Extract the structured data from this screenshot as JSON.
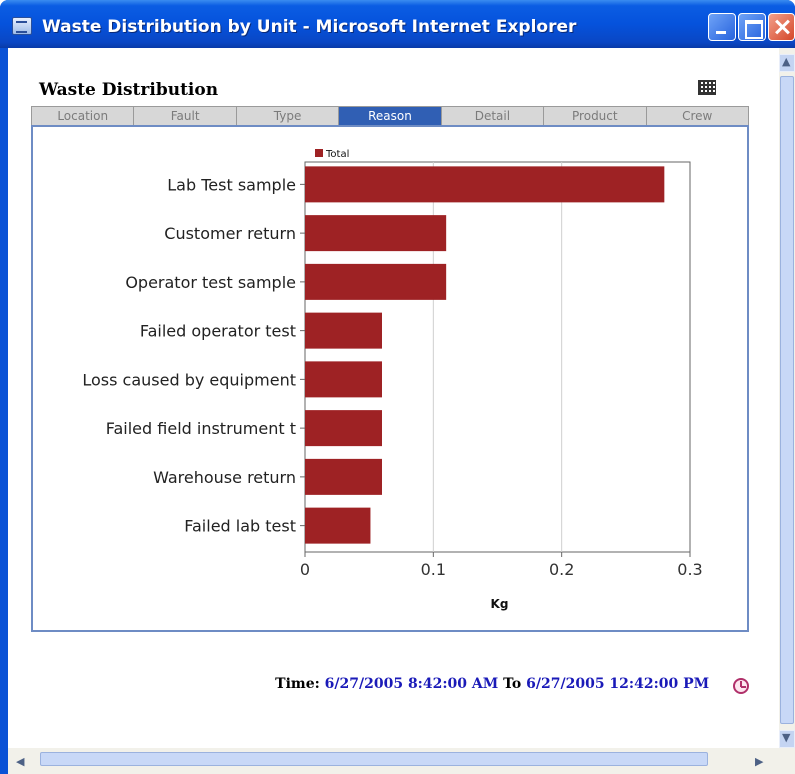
{
  "window": {
    "title": "Waste Distribution by Unit - Microsoft Internet Explorer"
  },
  "widget": {
    "title": "Waste Distribution",
    "grid_icon": "grid-view-icon"
  },
  "tabs": [
    {
      "label": "Location",
      "active": false
    },
    {
      "label": "Fault",
      "active": false
    },
    {
      "label": "Type",
      "active": false
    },
    {
      "label": "Reason",
      "active": true
    },
    {
      "label": "Detail",
      "active": false
    },
    {
      "label": "Product",
      "active": false
    },
    {
      "label": "Crew",
      "active": false
    }
  ],
  "chart_data": {
    "type": "bar",
    "orientation": "horizontal",
    "categories": [
      "Lab Test sample",
      "Customer return",
      "Operator test sample",
      "Failed operator test",
      "Loss caused by equipment",
      "Failed field instrument t",
      "Warehouse return",
      "Failed lab test"
    ],
    "series": [
      {
        "name": "Total",
        "values": [
          0.28,
          0.11,
          0.11,
          0.06,
          0.06,
          0.06,
          0.06,
          0.051
        ],
        "color": "#9e2224"
      }
    ],
    "xlabel": "Kg",
    "xlim": [
      0,
      0.3
    ],
    "xticks": [
      "0",
      "0.1",
      "0.2",
      "0.3"
    ],
    "grid": "vertical",
    "legend": "top-left"
  },
  "footer": {
    "time_label": "Time:",
    "start": "6/27/2005 8:42:00 AM",
    "to_label": "To",
    "end": "6/27/2005 12:42:00 PM"
  },
  "colors": {
    "titlebar": "#0552dc",
    "active_tab": "#305fb4",
    "bar": "#9e2224",
    "time_value": "#1a1ab8"
  }
}
